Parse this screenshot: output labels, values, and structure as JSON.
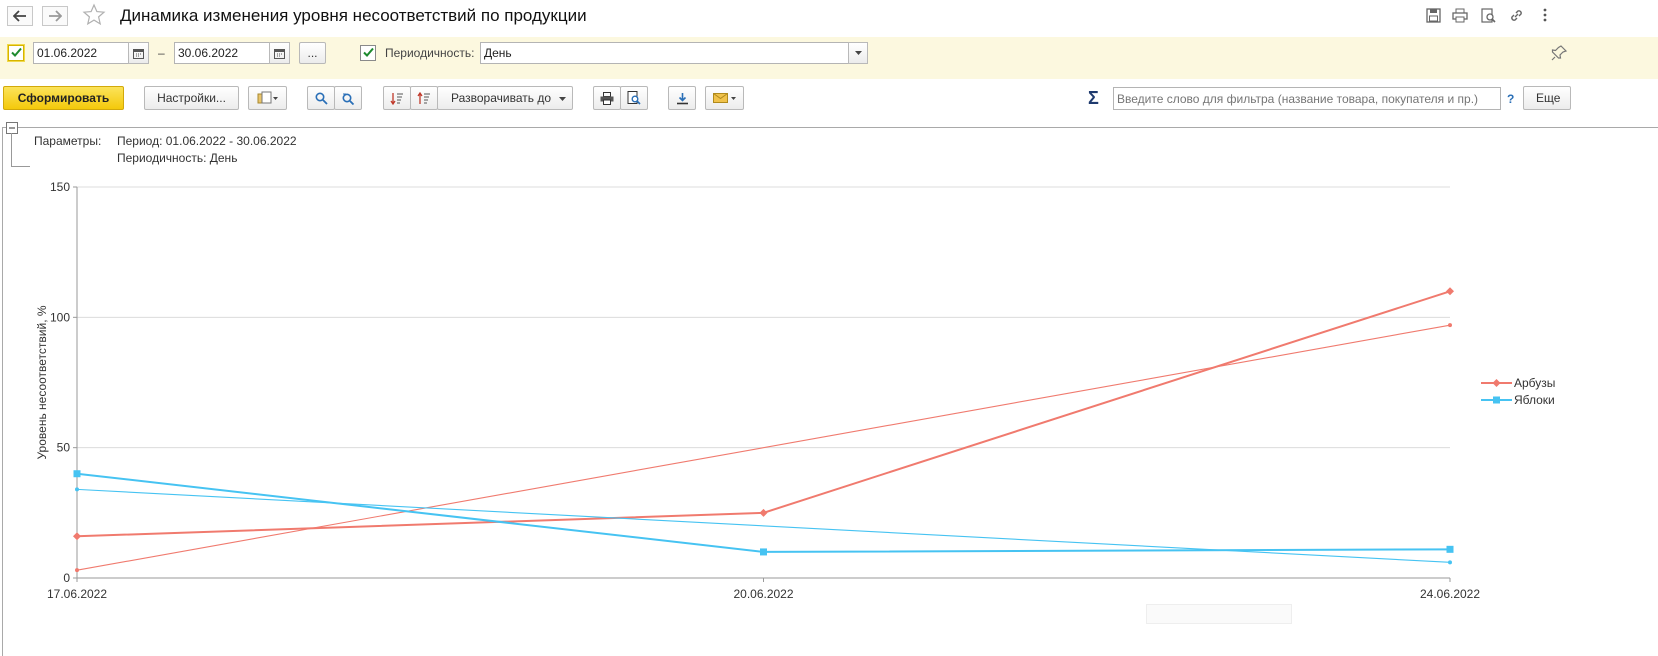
{
  "window": {
    "title": "Динамика изменения уровня несоответствий по продукции"
  },
  "filters": {
    "period_enabled": true,
    "date_from": "01.06.2022",
    "date_separator": "–",
    "date_to": "30.06.2022",
    "more_button": "...",
    "periodicity_enabled": true,
    "periodicity_label": "Периодичность:",
    "periodicity_value": "День"
  },
  "toolbar": {
    "generate_button": "Сформировать",
    "settings_button": "Настройки...",
    "expand_to_button": "Разворачивать до",
    "filter_placeholder": "Введите слово для фильтра (название товара, покупателя и пр.)",
    "help_label": "?",
    "more_button": "Еще",
    "sum_symbol": "Σ"
  },
  "report": {
    "params_label": "Параметры:",
    "period_text": "Период: 01.06.2022 - 30.06.2022",
    "periodicity_text": "Периодичность: День"
  },
  "chart_data": {
    "type": "line",
    "title": "",
    "ylabel": "Уровень несоответствий, %",
    "xlabel": "",
    "ylim": [
      0,
      150
    ],
    "yticks": [
      "0",
      "50",
      "100",
      "150"
    ],
    "categories": [
      "17.06.2022",
      "20.06.2022",
      "24.06.2022"
    ],
    "grid": true,
    "legend_position": "right",
    "series": [
      {
        "name": "Арбузы",
        "color": "#f07a6e",
        "marker": "diamond",
        "values": [
          16,
          25,
          110
        ],
        "trend": [
          3,
          97
        ]
      },
      {
        "name": "Яблоки",
        "color": "#46c3f2",
        "marker": "square",
        "values": [
          40,
          10,
          11
        ],
        "trend": [
          34,
          6
        ]
      }
    ]
  }
}
